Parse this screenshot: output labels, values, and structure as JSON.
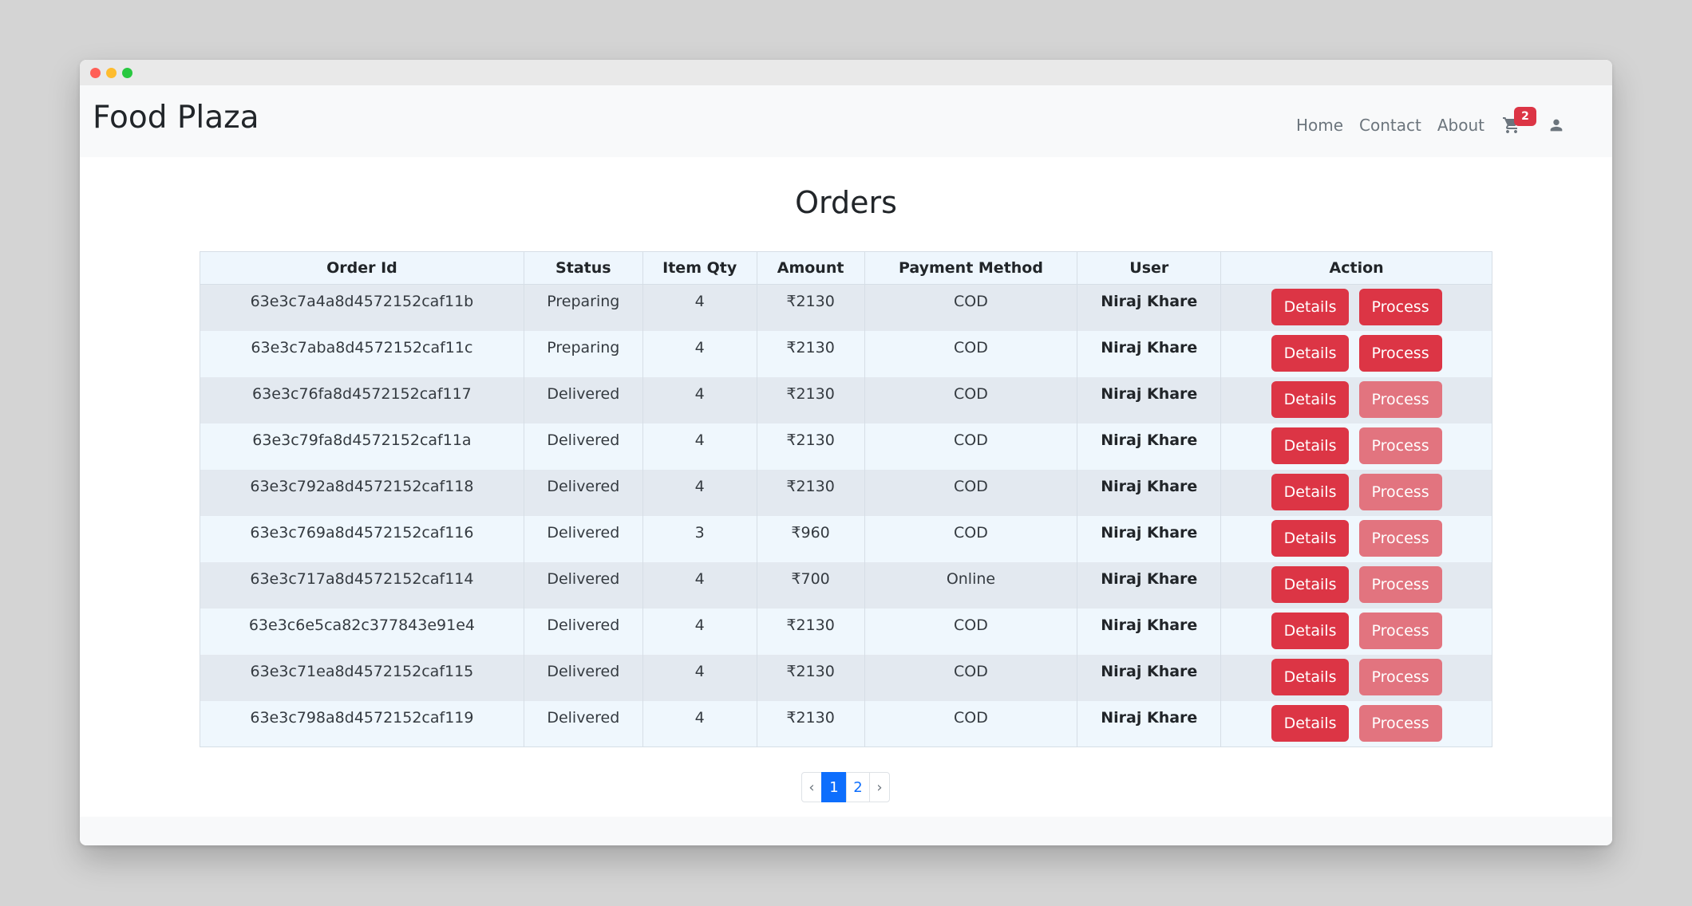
{
  "navbar": {
    "brand": "Food Plaza",
    "links": [
      "Home",
      "Contact",
      "About"
    ],
    "cart_count": "2"
  },
  "page": {
    "title": "Orders"
  },
  "table": {
    "headers": [
      "Order Id",
      "Status",
      "Item Qty",
      "Amount",
      "Payment Method",
      "User",
      "Action"
    ],
    "rows": [
      {
        "id": "63e3c7a4a8d4572152caf11b",
        "status": "Preparing",
        "qty": "4",
        "amount": "₹2130",
        "payment": "COD",
        "user": "Niraj Khare",
        "details": "Details",
        "process": "Process"
      },
      {
        "id": "63e3c7aba8d4572152caf11c",
        "status": "Preparing",
        "qty": "4",
        "amount": "₹2130",
        "payment": "COD",
        "user": "Niraj Khare",
        "details": "Details",
        "process": "Process"
      },
      {
        "id": "63e3c76fa8d4572152caf117",
        "status": "Delivered",
        "qty": "4",
        "amount": "₹2130",
        "payment": "COD",
        "user": "Niraj Khare",
        "details": "Details",
        "process": "Process"
      },
      {
        "id": "63e3c79fa8d4572152caf11a",
        "status": "Delivered",
        "qty": "4",
        "amount": "₹2130",
        "payment": "COD",
        "user": "Niraj Khare",
        "details": "Details",
        "process": "Process"
      },
      {
        "id": "63e3c792a8d4572152caf118",
        "status": "Delivered",
        "qty": "4",
        "amount": "₹2130",
        "payment": "COD",
        "user": "Niraj Khare",
        "details": "Details",
        "process": "Process"
      },
      {
        "id": "63e3c769a8d4572152caf116",
        "status": "Delivered",
        "qty": "3",
        "amount": "₹960",
        "payment": "COD",
        "user": "Niraj Khare",
        "details": "Details",
        "process": "Process"
      },
      {
        "id": "63e3c717a8d4572152caf114",
        "status": "Delivered",
        "qty": "4",
        "amount": "₹700",
        "payment": "Online",
        "user": "Niraj Khare",
        "details": "Details",
        "process": "Process"
      },
      {
        "id": "63e3c6e5ca82c377843e91e4",
        "status": "Delivered",
        "qty": "4",
        "amount": "₹2130",
        "payment": "COD",
        "user": "Niraj Khare",
        "details": "Details",
        "process": "Process"
      },
      {
        "id": "63e3c71ea8d4572152caf115",
        "status": "Delivered",
        "qty": "4",
        "amount": "₹2130",
        "payment": "COD",
        "user": "Niraj Khare",
        "details": "Details",
        "process": "Process"
      },
      {
        "id": "63e3c798a8d4572152caf119",
        "status": "Delivered",
        "qty": "4",
        "amount": "₹2130",
        "payment": "COD",
        "user": "Niraj Khare",
        "details": "Details",
        "process": "Process"
      }
    ]
  },
  "pagination": {
    "prev": "‹",
    "pages": [
      "1",
      "2"
    ],
    "next": "›",
    "active": "1"
  },
  "colors": {
    "danger": "#dc3545",
    "danger_disabled": "#e2747f",
    "primary": "#0d6efd"
  },
  "icons": {
    "cart": "cart-icon",
    "user": "user-icon"
  }
}
